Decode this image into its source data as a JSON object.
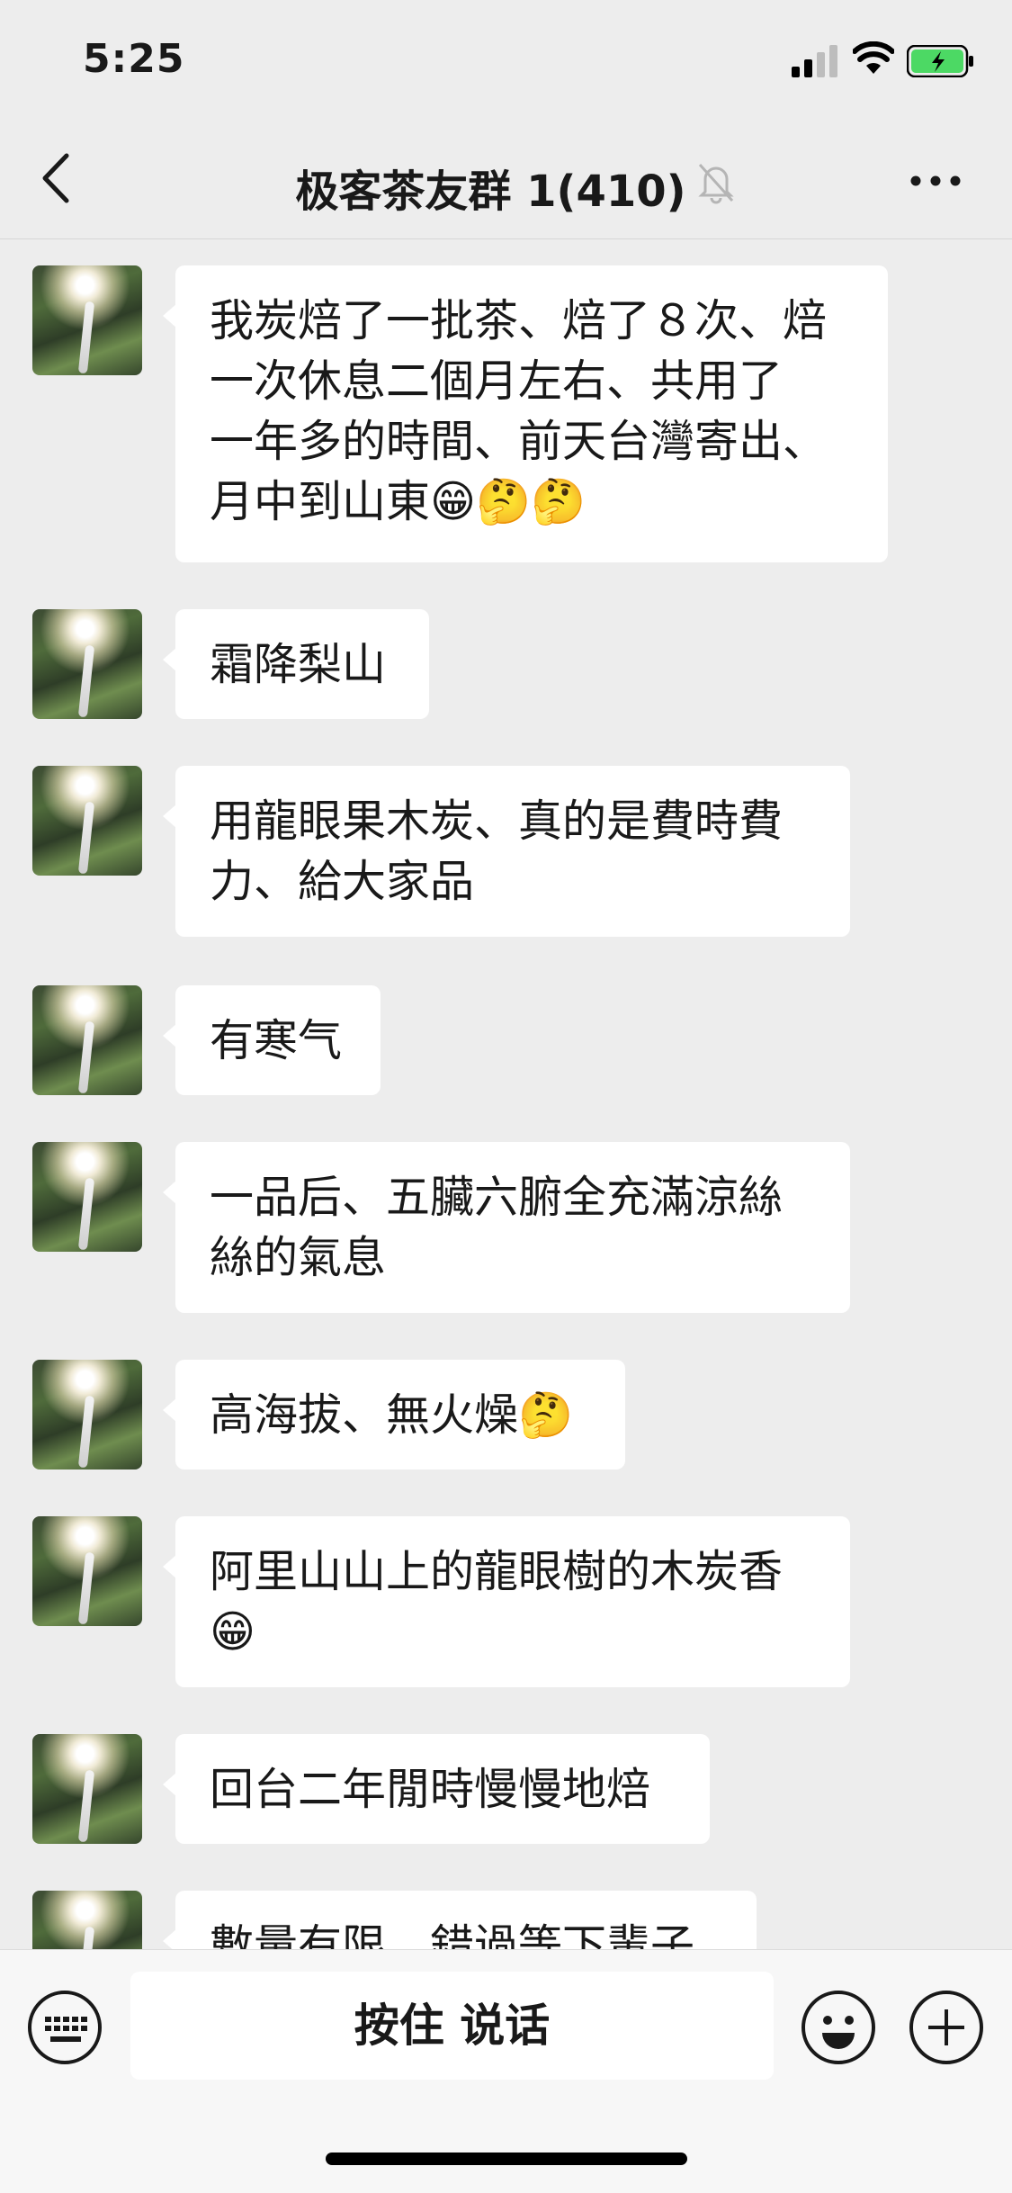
{
  "status_bar": {
    "time": "5:25"
  },
  "header": {
    "title": "极客茶友群 1(410)"
  },
  "messages": [
    {
      "text": "我炭焙了一批茶、焙了８次、焙\n一次休息二個月左右、共用了\n一年多的時間、前天台灣寄出、\n月中到山東😁🤔🤔"
    },
    {
      "text": "霜降梨山"
    },
    {
      "text": "用龍眼果木炭、真的是費時費\n力、給大家品"
    },
    {
      "text": "有寒气"
    },
    {
      "text": "一品后、五臟六腑全充滿涼絲\n絲的氣息"
    },
    {
      "text": "高海拔、無火燥🤔"
    },
    {
      "text": "阿里山山上的龍眼樹的木炭香\n😁"
    },
    {
      "text": "回台二年閒時慢慢地焙"
    },
    {
      "text": "數量有限、錯過等下輩子"
    }
  ],
  "input_bar": {
    "hold_to_talk_label": "按住 说话"
  },
  "icons": {
    "back": "back-arrow-icon",
    "mute": "mute-bell-icon",
    "more": "more-dots-icon",
    "keyboard": "keyboard-icon",
    "emoji": "emoji-icon",
    "plus": "plus-icon"
  },
  "colors": {
    "background": "#ededed",
    "bubble": "#ffffff",
    "battery_fill": "#4cd964"
  }
}
